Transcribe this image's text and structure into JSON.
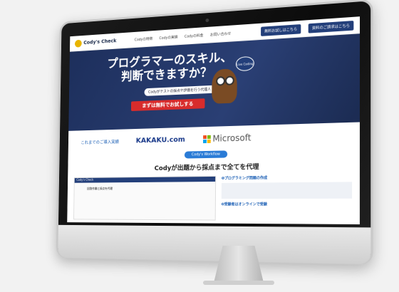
{
  "nav": {
    "logo_text": "Cody's Check",
    "links": [
      "Codyの特徴",
      "Codyの実績",
      "Codyの料金",
      "お問い合わせ"
    ],
    "cta_primary": "無料お試しはこちら",
    "cta_secondary": "資料のご請求はこちら"
  },
  "hero": {
    "title_line1": "プログラマーのスキル、",
    "title_line2": "判断できますか？",
    "subtitle": "Codyがテストの採点や評価を行う代理人",
    "cta": "まずは無料でお試しする",
    "bubble": "Live Coding"
  },
  "partners": {
    "label": "これまでのご導入実績",
    "kakaku": "KAKAKU.com",
    "microsoft": "Microsoft"
  },
  "workflow": {
    "tag": "Cody's Workflow",
    "title": "Codyが出題から採点まで全てを代理"
  },
  "bottom": {
    "mock_title": "Cody's Check",
    "mock_text": "回答作業と採点を代理",
    "side_heading1": "❶プログラミング問題の作成",
    "side_heading2": "❷受験者はオンラインで受験"
  },
  "colors": {
    "navy": "#233f7a",
    "red": "#d82c2c",
    "blue": "#2a7bd6"
  }
}
